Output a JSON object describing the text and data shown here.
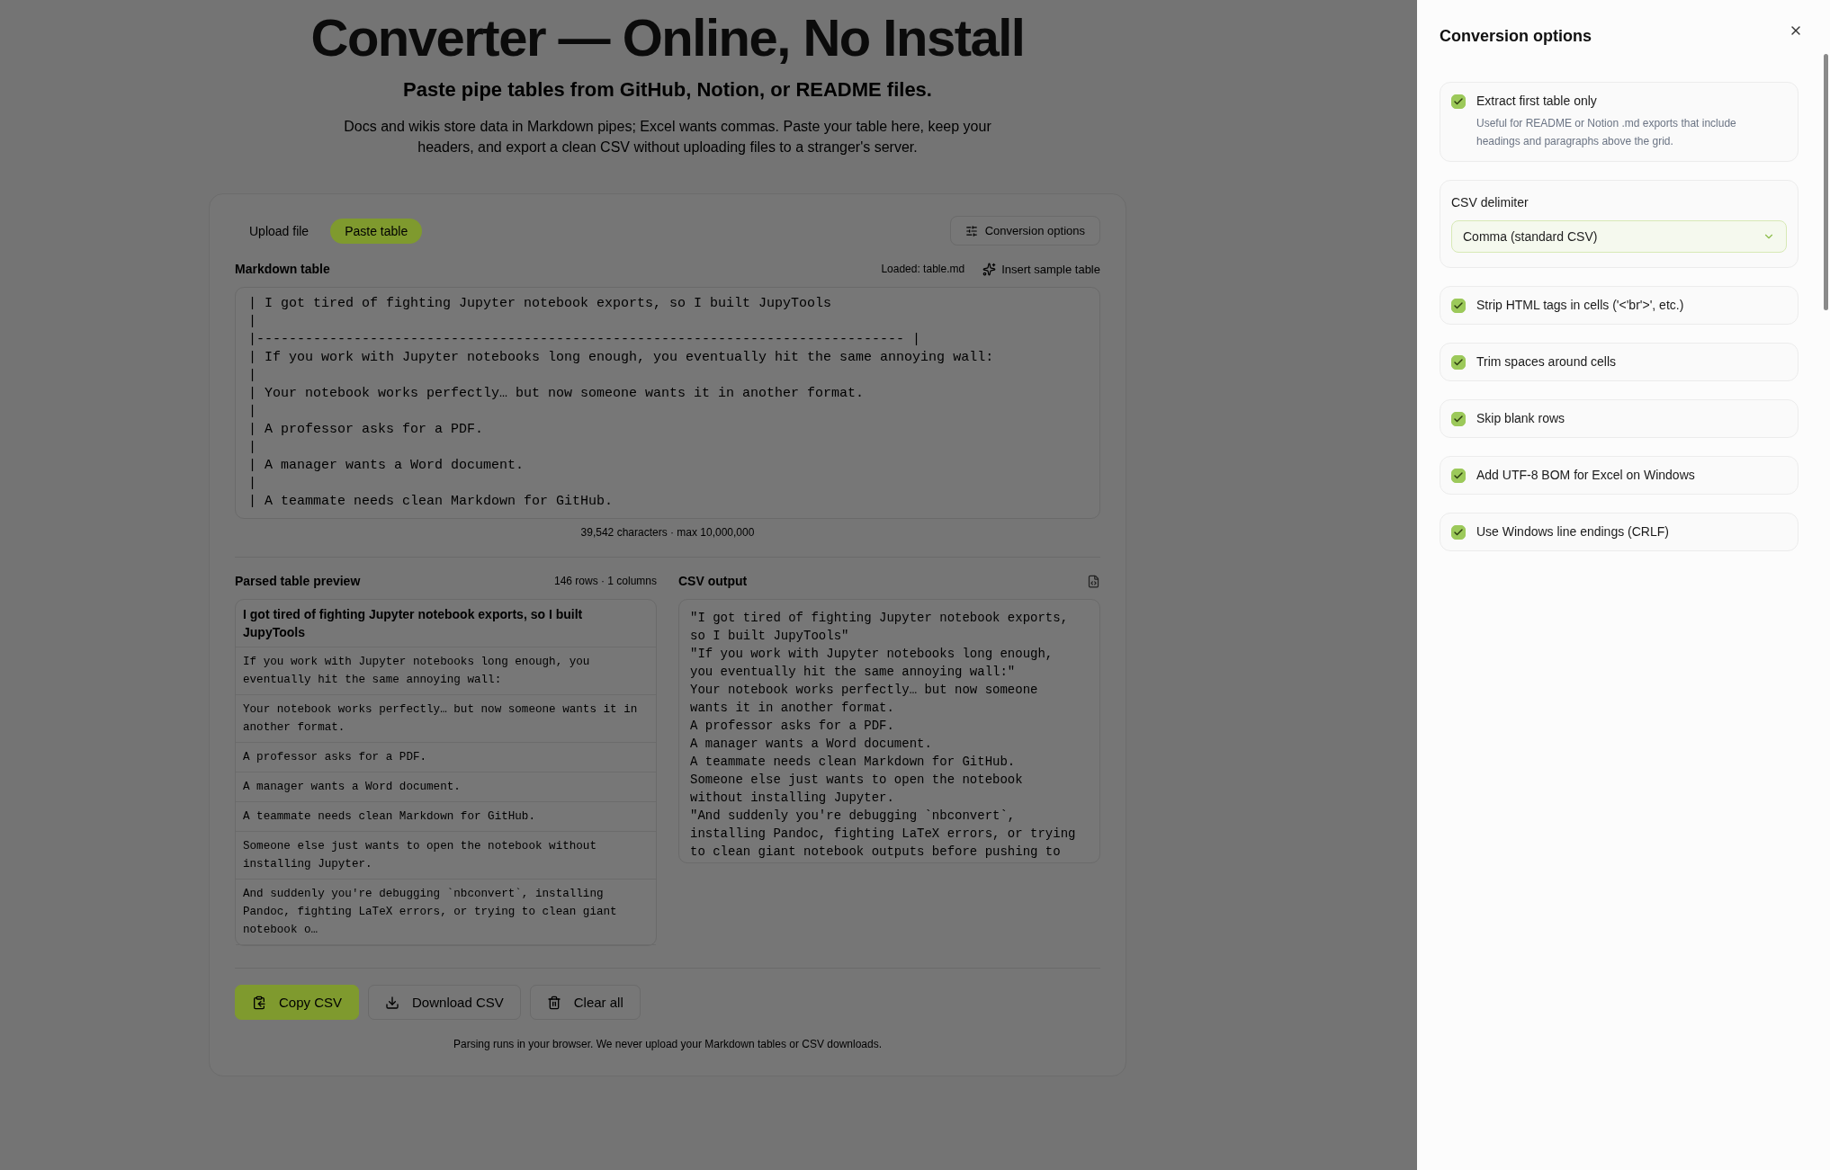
{
  "page": {
    "title": "Converter — Online, No Install",
    "subtitle": "Paste pipe tables from GitHub, Notion, or README files.",
    "description": "Docs and wikis store data in Markdown pipes; Excel wants commas. Paste your table here, keep your headers, and export a clean CSV without uploading files to a stranger's server."
  },
  "converter": {
    "tabs": [
      {
        "label": "Upload file",
        "selected": false
      },
      {
        "label": "Paste table",
        "selected": true
      }
    ],
    "options_button": "Conversion options",
    "input": {
      "label": "Markdown table",
      "loaded": "Loaded: table.md",
      "sample_button": "Insert sample table",
      "lines": [
        "| I got tired of fighting Jupyter notebook exports, so I built JupyTools",
        "|",
        "|-------------------------------------------------------------------------------- |",
        "| If you work with Jupyter notebooks long enough, you eventually hit the same annoying wall:",
        "|",
        "| Your notebook works perfectly… but now someone wants it in another format.",
        "|",
        "| A professor asks for a PDF.",
        "|",
        "| A manager wants a Word document.",
        "|",
        "| A teammate needs clean Markdown for GitHub."
      ],
      "counter": "39,542 characters · max 10,000,000"
    },
    "preview": {
      "title": "Parsed table preview",
      "meta": "146 rows · 1 columns",
      "rows": [
        {
          "text": "I got tired of fighting Jupyter notebook exports, so I built JupyTools",
          "header": true
        },
        {
          "text": "If you work with Jupyter notebooks long enough, you eventually hit the same annoying wall:",
          "header": false
        },
        {
          "text": "Your notebook works perfectly… but now someone wants it in another format.",
          "header": false
        },
        {
          "text": "A professor asks for a PDF.",
          "header": false
        },
        {
          "text": "A manager wants a Word document.",
          "header": false
        },
        {
          "text": "A teammate needs clean Markdown for GitHub.",
          "header": false
        },
        {
          "text": "Someone else just wants to open the notebook without installing Jupyter.",
          "header": false
        },
        {
          "text": "And suddenly you're debugging `nbconvert`, installing Pandoc, fighting LaTeX errors, or trying to clean giant notebook o…",
          "header": false
        }
      ]
    },
    "output": {
      "title": "CSV output",
      "lines": [
        "\"I got tired of fighting Jupyter notebook exports, so I built JupyTools\"",
        "\"If you work with Jupyter notebooks long enough, you eventually hit the same annoying wall:\"",
        "Your notebook works perfectly… but now someone wants it in another format.",
        "A professor asks for a PDF.",
        "A manager wants a Word document.",
        "A teammate needs clean Markdown for GitHub.",
        "Someone else just wants to open the notebook without installing Jupyter.",
        "\"And suddenly you're debugging `nbconvert`, installing Pandoc, fighting LaTeX errors, or trying to clean giant notebook outputs before pushing to"
      ]
    },
    "actions": [
      {
        "label": "Copy CSV",
        "kind": "copy",
        "primary": true
      },
      {
        "label": "Download CSV",
        "kind": "download",
        "primary": false
      },
      {
        "label": "Clear all",
        "kind": "clear",
        "primary": false
      }
    ],
    "footer": "Parsing runs in your browser. We never upload your Markdown tables or CSV downloads."
  },
  "panel": {
    "title": "Conversion options",
    "options": [
      {
        "kind": "checkbox",
        "label": "Extract first table only",
        "checked": true,
        "description": "Useful for README or Notion .md exports that include headings and paragraphs above the grid."
      },
      {
        "kind": "select",
        "label": "CSV delimiter",
        "value": "Comma (standard CSV)"
      },
      {
        "kind": "checkbox",
        "label": "Strip HTML tags in cells ('<'br'>', etc.)",
        "checked": true
      },
      {
        "kind": "checkbox",
        "label": "Trim spaces around cells",
        "checked": true
      },
      {
        "kind": "checkbox",
        "label": "Skip blank rows",
        "checked": true
      },
      {
        "kind": "checkbox",
        "label": "Add UTF-8 BOM for Excel on Windows",
        "checked": true
      },
      {
        "kind": "checkbox",
        "label": "Use Windows line endings (CRLF)",
        "checked": true
      }
    ]
  }
}
